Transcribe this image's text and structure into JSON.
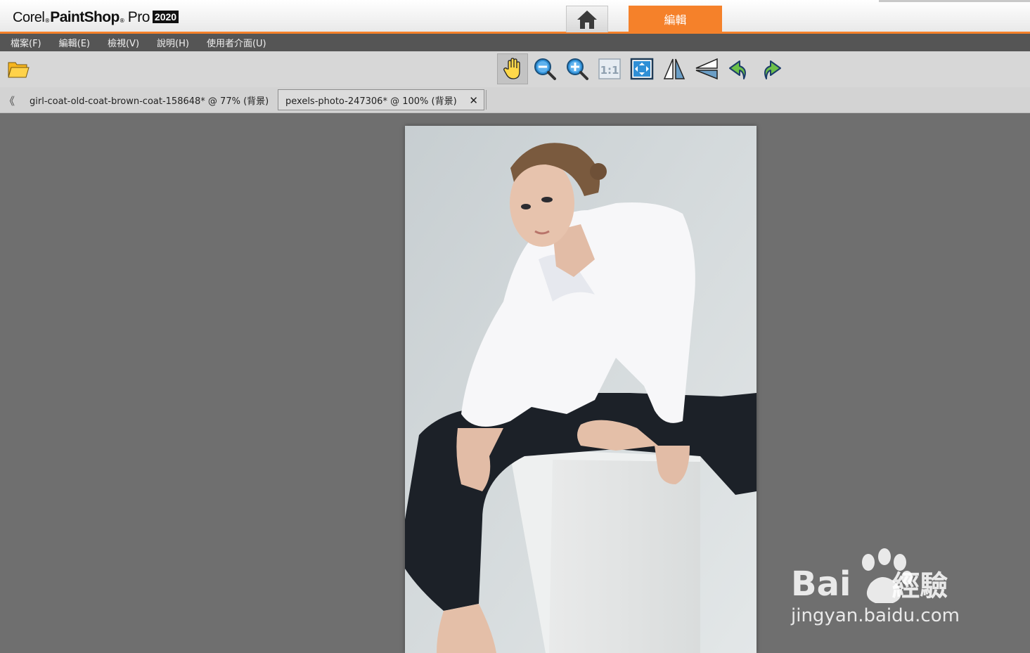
{
  "app": {
    "brand_corel": "Corel",
    "brand_paintshop": "PaintShop",
    "brand_pro": "Pro",
    "brand_year": "2020",
    "tabs": {
      "home_icon": "home-icon",
      "edit_label": "編輯"
    },
    "accent_color": "#f5812a"
  },
  "menu": {
    "items": [
      {
        "label": "檔案(F)"
      },
      {
        "label": "編輯(E)"
      },
      {
        "label": "檢視(V)"
      },
      {
        "label": "說明(H)"
      },
      {
        "label": "使用者介面(U)"
      }
    ]
  },
  "toolbar": {
    "tools": [
      "open-folder-icon",
      "pan-hand-icon",
      "zoom-out-icon",
      "zoom-in-icon",
      "actual-size-icon",
      "fit-to-window-icon",
      "flip-horizontal-icon",
      "flip-vertical-icon",
      "undo-icon",
      "redo-icon"
    ],
    "active_tool": "pan-hand-icon"
  },
  "documents": {
    "tabs": [
      {
        "label": "girl-coat-old-coat-brown-coat-158648*  @   77% (背景)"
      },
      {
        "label": "pexels-photo-247306*  @  100% (背景)"
      }
    ],
    "active_index": 1
  },
  "watermark": {
    "brand_text": "Bai",
    "brand_text2": "經驗",
    "url": "jingyan.baidu.com"
  }
}
